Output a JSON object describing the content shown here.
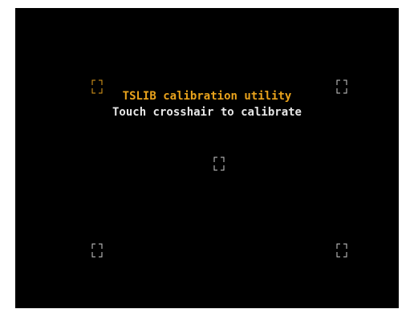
{
  "calibration": {
    "title": "TSLIB calibration utility",
    "instruction": "Touch crosshair to calibrate"
  },
  "colors": {
    "background": "#000000",
    "title": "#e8a21c",
    "instruction": "#e6e6e6",
    "crosshair_active": "#e8a21c",
    "crosshair_inactive": "#cfcfcf"
  },
  "crosshairs": [
    {
      "id": "top-left",
      "state": "active"
    },
    {
      "id": "top-right",
      "state": "inactive"
    },
    {
      "id": "center",
      "state": "inactive"
    },
    {
      "id": "bottom-left",
      "state": "inactive"
    },
    {
      "id": "bottom-right",
      "state": "inactive"
    }
  ]
}
